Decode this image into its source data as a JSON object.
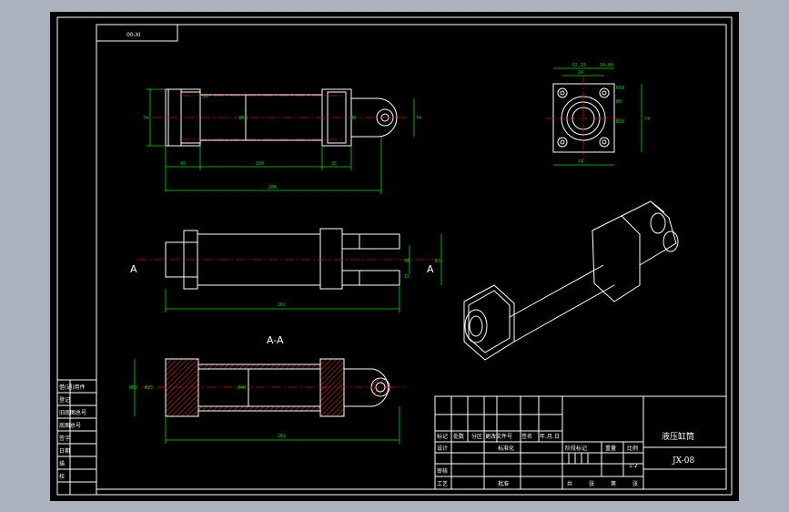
{
  "drawing": {
    "drawing_code_rotated": "00-XI",
    "section_label": "A-A",
    "section_arrow_left": "A",
    "section_arrow_right": "A",
    "view1_dims": {
      "height_left": "74",
      "bore": "Ø63",
      "d_rod": "18",
      "d_right": "74",
      "eye": "Ø8",
      "seg_a": "45",
      "seg_b": "150",
      "seg_c": "35",
      "total": "266"
    },
    "view2_dims": {
      "total": "262",
      "d1": "30",
      "d2": "15",
      "d3": "63"
    },
    "view3_dims": {
      "bore": "Ø63",
      "d1": "Ø25",
      "d2": "Ø40",
      "total": "262"
    },
    "end_view_dims": {
      "top1": "52.15",
      "top2": "18.80",
      "w1": "24",
      "w2": "R18",
      "h1": "Ø8",
      "h2": "Ø20",
      "h3": "74",
      "bottom": "74"
    },
    "left_block_labels": [
      "借(通)用件",
      "登记",
      "旧底图总号",
      "底图总号",
      "签字",
      "日期",
      "描",
      "校"
    ],
    "title_block": {
      "headers": [
        "标记",
        "处数",
        "分区",
        "更改文件号",
        "签名",
        "年.月.日"
      ],
      "row2": [
        "设计",
        "",
        "",
        "标准化",
        "",
        ""
      ],
      "row3": [
        "审核",
        "",
        "",
        "",
        "",
        ""
      ],
      "row4": [
        "工艺",
        "",
        "",
        "批准",
        "",
        ""
      ],
      "stage_labels": [
        "阶段标记",
        "重量",
        "比例"
      ],
      "scale": "1:2",
      "sheet_row": [
        "共",
        "张",
        "第",
        "张"
      ],
      "part_name": "液压缸筒",
      "drawing_no": "JX-08"
    }
  },
  "colors": {
    "background": "#000000",
    "frame": "#ffffff",
    "dimension": "#00e000",
    "centerline": "#e00000",
    "hatch": "#ff3030",
    "window_bg": "#a9b2bd"
  }
}
